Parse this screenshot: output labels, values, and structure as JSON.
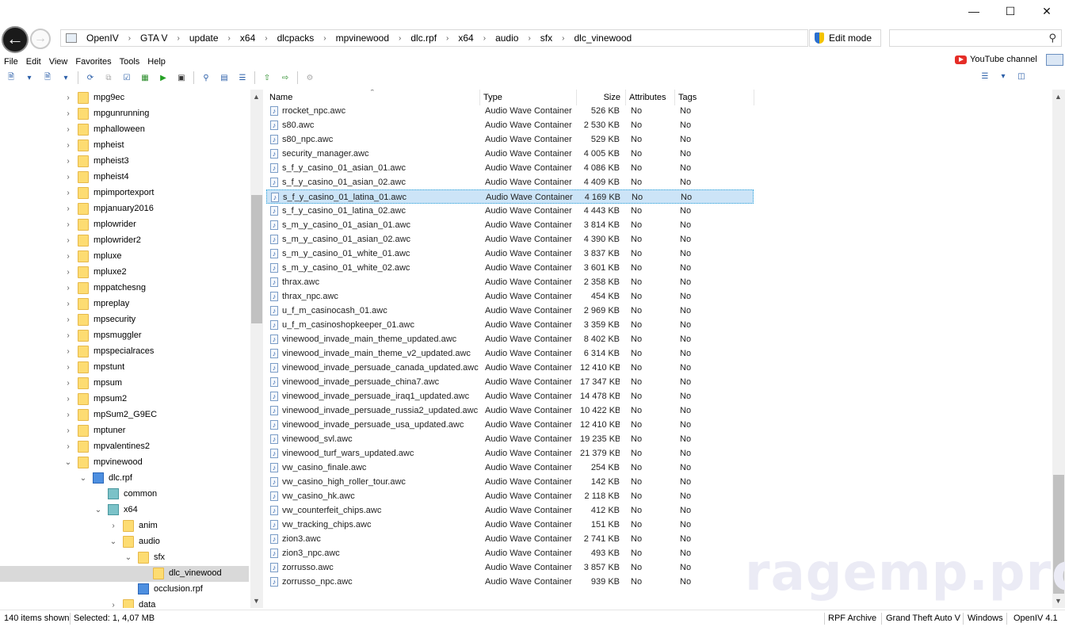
{
  "window": {
    "controls": {
      "minimize": "—",
      "maximize": "☐",
      "close": "✕"
    }
  },
  "address": {
    "crumbs": [
      "OpenIV",
      "GTA V",
      "update",
      "x64",
      "dlcpacks",
      "mpvinewood",
      "dlc.rpf",
      "x64",
      "audio",
      "sfx",
      "dlc_vinewood"
    ],
    "edit_mode_label": "Edit mode",
    "search_placeholder": ""
  },
  "menu": [
    "File",
    "Edit",
    "View",
    "Favorites",
    "Tools",
    "Help"
  ],
  "youtube_label": "YouTube channel",
  "tree": [
    {
      "label": "mpg9ec",
      "icon": "folder",
      "expander": "right"
    },
    {
      "label": "mpgunrunning",
      "icon": "folder",
      "expander": "right"
    },
    {
      "label": "mphalloween",
      "icon": "folder",
      "expander": "right"
    },
    {
      "label": "mpheist",
      "icon": "folder",
      "expander": "right"
    },
    {
      "label": "mpheist3",
      "icon": "folder",
      "expander": "right"
    },
    {
      "label": "mpheist4",
      "icon": "folder",
      "expander": "right"
    },
    {
      "label": "mpimportexport",
      "icon": "folder",
      "expander": "right"
    },
    {
      "label": "mpjanuary2016",
      "icon": "folder",
      "expander": "right"
    },
    {
      "label": "mplowrider",
      "icon": "folder",
      "expander": "right"
    },
    {
      "label": "mplowrider2",
      "icon": "folder",
      "expander": "right"
    },
    {
      "label": "mpluxe",
      "icon": "folder",
      "expander": "right"
    },
    {
      "label": "mpluxe2",
      "icon": "folder",
      "expander": "right"
    },
    {
      "label": "mppatchesng",
      "icon": "folder",
      "expander": "right"
    },
    {
      "label": "mpreplay",
      "icon": "folder",
      "expander": "right"
    },
    {
      "label": "mpsecurity",
      "icon": "folder",
      "expander": "right"
    },
    {
      "label": "mpsmuggler",
      "icon": "folder",
      "expander": "right"
    },
    {
      "label": "mpspecialraces",
      "icon": "folder",
      "expander": "right"
    },
    {
      "label": "mpstunt",
      "icon": "folder",
      "expander": "right"
    },
    {
      "label": "mpsum",
      "icon": "folder",
      "expander": "right"
    },
    {
      "label": "mpsum2",
      "icon": "folder",
      "expander": "right"
    },
    {
      "label": "mpSum2_G9EC",
      "icon": "folder",
      "expander": "right"
    },
    {
      "label": "mptuner",
      "icon": "folder",
      "expander": "right"
    },
    {
      "label": "mpvalentines2",
      "icon": "folder",
      "expander": "right"
    },
    {
      "label": "mpvinewood",
      "icon": "folder",
      "expander": "down"
    },
    {
      "label": "dlc.rpf",
      "icon": "rpf",
      "expander": "down"
    },
    {
      "label": "common",
      "icon": "dir",
      "expander": "none"
    },
    {
      "label": "x64",
      "icon": "dir",
      "expander": "down"
    },
    {
      "label": "anim",
      "icon": "folder",
      "expander": "right"
    },
    {
      "label": "audio",
      "icon": "folder",
      "expander": "down"
    },
    {
      "label": "sfx",
      "icon": "folder-open",
      "expander": "down"
    },
    {
      "label": "dlc_vinewood",
      "icon": "folder",
      "expander": "none",
      "selected": true
    },
    {
      "label": "occlusion.rpf",
      "icon": "rpf",
      "expander": "none"
    },
    {
      "label": "data",
      "icon": "folder-open",
      "expander": "right"
    }
  ],
  "columns": {
    "name": "Name",
    "type": "Type",
    "size": "Size",
    "attributes": "Attributes",
    "tags": "Tags"
  },
  "files": [
    {
      "name": "rrocket_npc.awc",
      "type": "Audio Wave Container",
      "size": "526 KB",
      "attr": "No",
      "tags": "No"
    },
    {
      "name": "s80.awc",
      "type": "Audio Wave Container",
      "size": "2 530 KB",
      "attr": "No",
      "tags": "No"
    },
    {
      "name": "s80_npc.awc",
      "type": "Audio Wave Container",
      "size": "529 KB",
      "attr": "No",
      "tags": "No"
    },
    {
      "name": "security_manager.awc",
      "type": "Audio Wave Container",
      "size": "4 005 KB",
      "attr": "No",
      "tags": "No"
    },
    {
      "name": "s_f_y_casino_01_asian_01.awc",
      "type": "Audio Wave Container",
      "size": "4 086 KB",
      "attr": "No",
      "tags": "No"
    },
    {
      "name": "s_f_y_casino_01_asian_02.awc",
      "type": "Audio Wave Container",
      "size": "4 409 KB",
      "attr": "No",
      "tags": "No"
    },
    {
      "name": "s_f_y_casino_01_latina_01.awc",
      "type": "Audio Wave Container",
      "size": "4 169 KB",
      "attr": "No",
      "tags": "No",
      "selected": true
    },
    {
      "name": "s_f_y_casino_01_latina_02.awc",
      "type": "Audio Wave Container",
      "size": "4 443 KB",
      "attr": "No",
      "tags": "No"
    },
    {
      "name": "s_m_y_casino_01_asian_01.awc",
      "type": "Audio Wave Container",
      "size": "3 814 KB",
      "attr": "No",
      "tags": "No"
    },
    {
      "name": "s_m_y_casino_01_asian_02.awc",
      "type": "Audio Wave Container",
      "size": "4 390 KB",
      "attr": "No",
      "tags": "No"
    },
    {
      "name": "s_m_y_casino_01_white_01.awc",
      "type": "Audio Wave Container",
      "size": "3 837 KB",
      "attr": "No",
      "tags": "No"
    },
    {
      "name": "s_m_y_casino_01_white_02.awc",
      "type": "Audio Wave Container",
      "size": "3 601 KB",
      "attr": "No",
      "tags": "No"
    },
    {
      "name": "thrax.awc",
      "type": "Audio Wave Container",
      "size": "2 358 KB",
      "attr": "No",
      "tags": "No"
    },
    {
      "name": "thrax_npc.awc",
      "type": "Audio Wave Container",
      "size": "454 KB",
      "attr": "No",
      "tags": "No"
    },
    {
      "name": "u_f_m_casinocash_01.awc",
      "type": "Audio Wave Container",
      "size": "2 969 KB",
      "attr": "No",
      "tags": "No"
    },
    {
      "name": "u_f_m_casinoshopkeeper_01.awc",
      "type": "Audio Wave Container",
      "size": "3 359 KB",
      "attr": "No",
      "tags": "No"
    },
    {
      "name": "vinewood_invade_main_theme_updated.awc",
      "type": "Audio Wave Container",
      "size": "8 402 KB",
      "attr": "No",
      "tags": "No"
    },
    {
      "name": "vinewood_invade_main_theme_v2_updated.awc",
      "type": "Audio Wave Container",
      "size": "6 314 KB",
      "attr": "No",
      "tags": "No"
    },
    {
      "name": "vinewood_invade_persuade_canada_updated.awc",
      "type": "Audio Wave Container",
      "size": "12 410 KB",
      "attr": "No",
      "tags": "No"
    },
    {
      "name": "vinewood_invade_persuade_china7.awc",
      "type": "Audio Wave Container",
      "size": "17 347 KB",
      "attr": "No",
      "tags": "No"
    },
    {
      "name": "vinewood_invade_persuade_iraq1_updated.awc",
      "type": "Audio Wave Container",
      "size": "14 478 KB",
      "attr": "No",
      "tags": "No"
    },
    {
      "name": "vinewood_invade_persuade_russia2_updated.awc",
      "type": "Audio Wave Container",
      "size": "10 422 KB",
      "attr": "No",
      "tags": "No"
    },
    {
      "name": "vinewood_invade_persuade_usa_updated.awc",
      "type": "Audio Wave Container",
      "size": "12 410 KB",
      "attr": "No",
      "tags": "No"
    },
    {
      "name": "vinewood_svl.awc",
      "type": "Audio Wave Container",
      "size": "19 235 KB",
      "attr": "No",
      "tags": "No"
    },
    {
      "name": "vinewood_turf_wars_updated.awc",
      "type": "Audio Wave Container",
      "size": "21 379 KB",
      "attr": "No",
      "tags": "No"
    },
    {
      "name": "vw_casino_finale.awc",
      "type": "Audio Wave Container",
      "size": "254 KB",
      "attr": "No",
      "tags": "No"
    },
    {
      "name": "vw_casino_high_roller_tour.awc",
      "type": "Audio Wave Container",
      "size": "142 KB",
      "attr": "No",
      "tags": "No"
    },
    {
      "name": "vw_casino_hk.awc",
      "type": "Audio Wave Container",
      "size": "2 118 KB",
      "attr": "No",
      "tags": "No"
    },
    {
      "name": "vw_counterfeit_chips.awc",
      "type": "Audio Wave Container",
      "size": "412 KB",
      "attr": "No",
      "tags": "No"
    },
    {
      "name": "vw_tracking_chips.awc",
      "type": "Audio Wave Container",
      "size": "151 KB",
      "attr": "No",
      "tags": "No"
    },
    {
      "name": "zion3.awc",
      "type": "Audio Wave Container",
      "size": "2 741 KB",
      "attr": "No",
      "tags": "No"
    },
    {
      "name": "zion3_npc.awc",
      "type": "Audio Wave Container",
      "size": "493 KB",
      "attr": "No",
      "tags": "No"
    },
    {
      "name": "zorrusso.awc",
      "type": "Audio Wave Container",
      "size": "3 857 KB",
      "attr": "No",
      "tags": "No"
    },
    {
      "name": "zorrusso_npc.awc",
      "type": "Audio Wave Container",
      "size": "939 KB",
      "attr": "No",
      "tags": "No"
    }
  ],
  "watermark": "ragemp.pro",
  "status": {
    "items_shown": "140 items shown",
    "selected": "Selected: 1,  4,07 MB",
    "archive": "RPF Archive",
    "game": "Grand Theft Auto V",
    "platform": "Windows",
    "version": "OpenIV 4.1"
  }
}
